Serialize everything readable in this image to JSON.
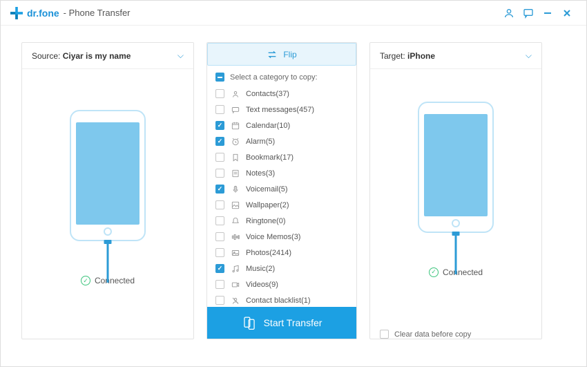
{
  "app": {
    "brand": "dr.fone",
    "subtitle": "- Phone Transfer"
  },
  "source": {
    "label": "Source:",
    "name": "Ciyar is my name",
    "status": "Connected"
  },
  "target": {
    "label": "Target:",
    "name": "iPhone",
    "status": "Connected"
  },
  "flip": {
    "label": "Flip"
  },
  "categories": {
    "header": "Select a category to copy:",
    "items": [
      {
        "label": "Contacts(37)",
        "checked": false,
        "icon": "contact"
      },
      {
        "label": "Text messages(457)",
        "checked": false,
        "icon": "message"
      },
      {
        "label": "Calendar(10)",
        "checked": true,
        "icon": "calendar"
      },
      {
        "label": "Alarm(5)",
        "checked": true,
        "icon": "alarm"
      },
      {
        "label": "Bookmark(17)",
        "checked": false,
        "icon": "bookmark"
      },
      {
        "label": "Notes(3)",
        "checked": false,
        "icon": "notes"
      },
      {
        "label": "Voicemail(5)",
        "checked": true,
        "icon": "voicemail"
      },
      {
        "label": "Wallpaper(2)",
        "checked": false,
        "icon": "wallpaper"
      },
      {
        "label": "Ringtone(0)",
        "checked": false,
        "icon": "ringtone"
      },
      {
        "label": "Voice Memos(3)",
        "checked": false,
        "icon": "voicememo"
      },
      {
        "label": "Photos(2414)",
        "checked": false,
        "icon": "photos"
      },
      {
        "label": "Music(2)",
        "checked": true,
        "icon": "music"
      },
      {
        "label": "Videos(9)",
        "checked": false,
        "icon": "videos"
      },
      {
        "label": "Contact blacklist(1)",
        "checked": false,
        "icon": "blacklist"
      }
    ]
  },
  "start": {
    "label": "Start Transfer"
  },
  "clear": {
    "label": "Clear data before copy",
    "checked": false
  }
}
